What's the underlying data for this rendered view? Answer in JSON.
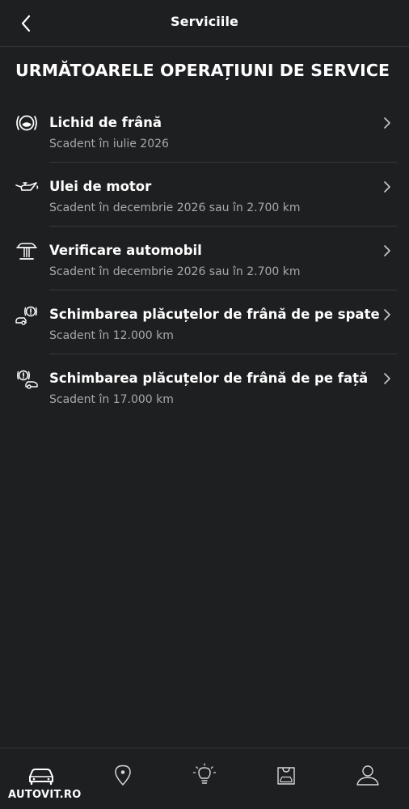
{
  "header": {
    "title": "Serviciile",
    "back_icon": "chevron-left-icon"
  },
  "section_title": "URMĂTOARELE OPERAȚIUNI DE SERVICE",
  "items": [
    {
      "title": "Lichid de frână",
      "subtitle": "Scadent în iulie 2026",
      "icon": "brake-fluid-icon"
    },
    {
      "title": "Ulei de motor",
      "subtitle": "Scadent în decembrie 2026 sau în 2.700 km",
      "icon": "oil-can-icon"
    },
    {
      "title": "Verificare automobil",
      "subtitle": "Scadent în decembrie 2026 sau în 2.700 km",
      "icon": "car-lift-icon"
    },
    {
      "title": "Schimbarea plăcuțelor de frână de pe spate",
      "subtitle": "Scadent în 12.000 km",
      "icon": "rear-brake-pads-icon"
    },
    {
      "title": "Schimbarea plăcuțelor de frână de pe față",
      "subtitle": "Scadent în 17.000 km",
      "icon": "front-brake-pads-icon"
    }
  ],
  "tabbar": [
    {
      "icon": "car-icon",
      "active": true
    },
    {
      "icon": "location-pin-icon",
      "active": false
    },
    {
      "icon": "lightbulb-icon",
      "active": false
    },
    {
      "icon": "shopping-bag-icon",
      "active": false
    },
    {
      "icon": "profile-icon",
      "active": false
    }
  ],
  "watermark": "AUTOVIT.RO",
  "colors": {
    "background": "#1e1f21",
    "text": "#ffffff",
    "secondary_text": "#a6a8ab",
    "divider": "#38393c"
  }
}
